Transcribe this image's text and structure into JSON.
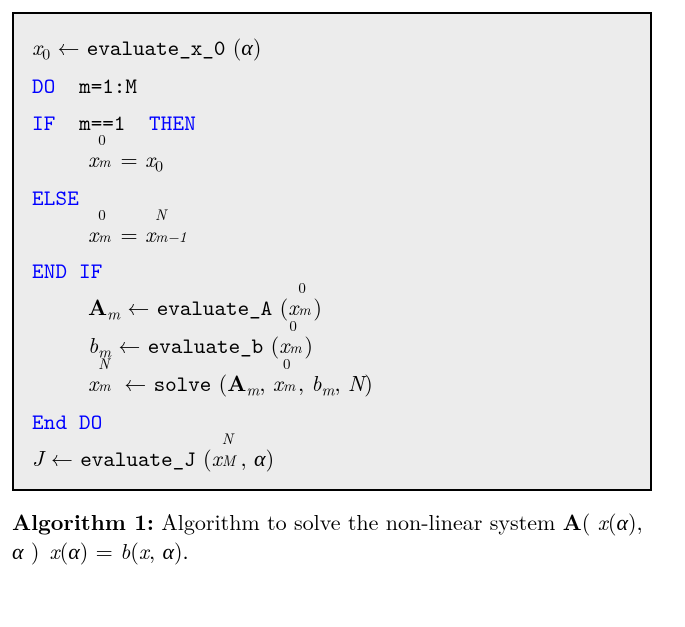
{
  "algo": {
    "l1_x0": "x",
    "l1_sub0": "0",
    "l1_arrow": " ← ",
    "l1_fn": "evaluate_x_0",
    "l1_open": " (",
    "l1_alpha": "α",
    "l1_close": ")",
    "l2_do": "DO",
    "l2_cond": " m=1:M",
    "l3_if": "IF",
    "l3_cond": " m==1 ",
    "l3_then": "THEN",
    "l4_xm": "x",
    "l4_ss_sup": "0",
    "l4_ss_sub": "m",
    "l4_eq": " = ",
    "l4_rhs_x": "x",
    "l4_rhs_sub": "0",
    "l5_else": "ELSE",
    "l6_xm": "x",
    "l6_ss_sup": "0",
    "l6_ss_sub": "m",
    "l6_eq": " = ",
    "l6_rhs_x": "x",
    "l6_rhs_sup": "N",
    "l6_rhs_sub": "m−1",
    "l7_endif": "END IF",
    "l8_A": "A",
    "l8_sub": "m",
    "l8_arrow": " ← ",
    "l8_fn": "evaluate_A",
    "l8_open": " (",
    "l8_argx": "x",
    "l8_arg_sup": "0",
    "l8_arg_sub": "m",
    "l8_close": ")",
    "l9_b": "b",
    "l9_sub": "m",
    "l9_arrow": " ← ",
    "l9_fn": "evaluate_b",
    "l9_open": " (",
    "l9_argx": "x",
    "l9_arg_sup": "0",
    "l9_arg_sub": "m",
    "l9_close": ")",
    "l10_x": "x",
    "l10_x_sup": "N",
    "l10_x_sub": "m",
    "l10_arrow": " ← ",
    "l10_fn": "solve",
    "l10_open": " (",
    "l10_A": "A",
    "l10_A_sub": "m",
    "l10_c1": ", ",
    "l10_x2": "x",
    "l10_x2_sup": "0",
    "l10_x2_sub": "m",
    "l10_c2": ", ",
    "l10_b": "b",
    "l10_b_sub": "m",
    "l10_c3": ", ",
    "l10_N": "N",
    "l10_close": ")",
    "l11_enddo": "End DO",
    "l12_J": "J",
    "l12_arrow": " ← ",
    "l12_fn": "evaluate_J",
    "l12_open": " (",
    "l12_x": "x",
    "l12_x_sup": "N",
    "l12_x_sub": "M",
    "l12_c": ", ",
    "l12_alpha": "α",
    "l12_close": ")"
  },
  "caption": {
    "label": "Algorithm 1:",
    "pre": " Algorithm to solve the non-linear system ",
    "A": "A",
    "op1": "( ",
    "x1": "x",
    "op2": "(",
    "a1": "α",
    "op3": "),  ",
    "a2": "α",
    "op4": " ) ",
    "x2": "x",
    "op5": "(",
    "a3": "α",
    "op6": ") = ",
    "b": "b",
    "op7": "(",
    "x3": "x",
    "c": ", ",
    "a4": "α",
    "op8": ").",
    "post": ""
  }
}
